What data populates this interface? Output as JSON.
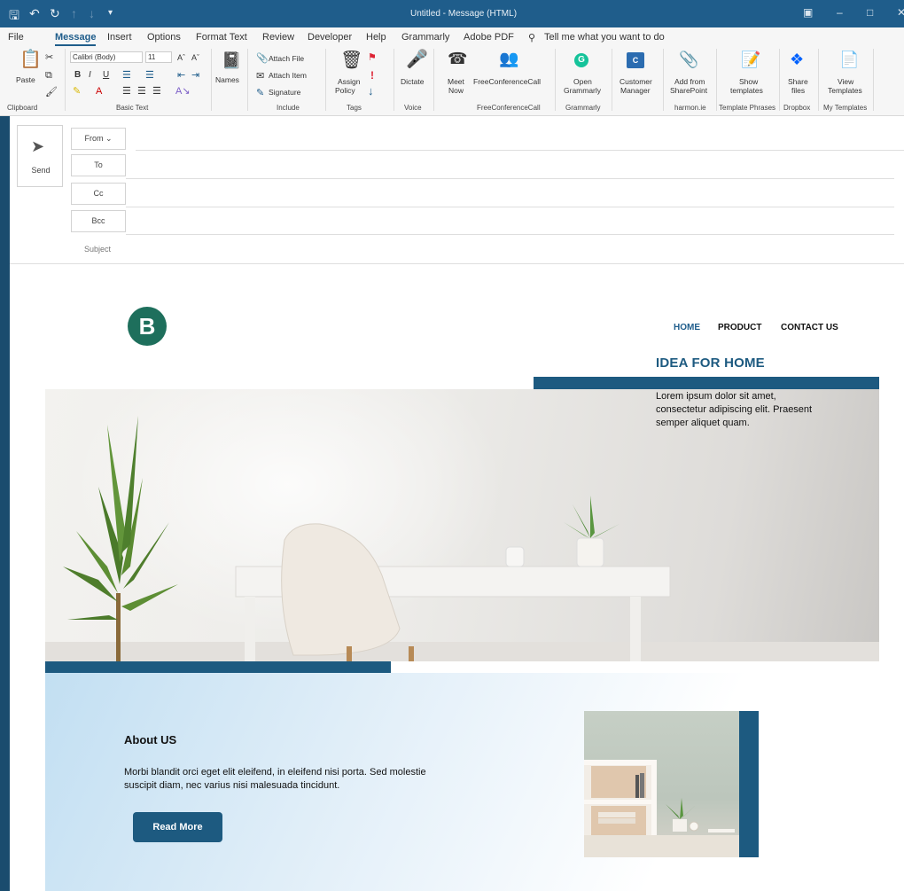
{
  "window": {
    "title": "Untitled  -  Message (HTML)"
  },
  "menu": {
    "items": [
      "File",
      "Message",
      "Insert",
      "Options",
      "Format Text",
      "Review",
      "Developer",
      "Help",
      "Grammarly",
      "Adobe PDF"
    ],
    "tell_me": "Tell me what you want to do"
  },
  "ribbon": {
    "paste": "Paste",
    "font_name": "Calibri (Body)",
    "font_size": "11",
    "names": "Names",
    "attach_file": "Attach File",
    "attach_item": "Attach Item",
    "signature": "Signature",
    "assign_policy_1": "Assign",
    "assign_policy_2": "Policy",
    "dictate": "Dictate",
    "meet_now_1": "Meet",
    "meet_now_2": "Now",
    "freeconference": "FreeConferenceCall",
    "open_grammarly_1": "Open",
    "open_grammarly_2": "Grammarly",
    "customer_manager_1": "Customer",
    "customer_manager_2": "Manager",
    "add_sharepoint_1": "Add from",
    "add_sharepoint_2": "SharePoint",
    "show_templates_1": "Show",
    "show_templates_2": "templates",
    "share_files_1": "Share",
    "share_files_2": "files",
    "view_templates_1": "View",
    "view_templates_2": "Templates",
    "groups": {
      "clipboard": "Clipboard",
      "basic_text": "Basic Text",
      "include": "Include",
      "tags": "Tags",
      "voice": "Voice",
      "freeconferencecall": "FreeConferenceCall",
      "grammarly": "Grammarly",
      "harmonie": "harmon.ie",
      "template_phrases": "Template Phrases",
      "dropbox": "Dropbox",
      "my_templates": "My Templates"
    }
  },
  "compose": {
    "send": "Send",
    "from": "From",
    "to": "To",
    "cc": "Cc",
    "bcc": "Bcc",
    "subject": "Subject"
  },
  "email": {
    "logo": "B",
    "nav": {
      "home": "HOME",
      "product": "PRODUCT",
      "contact": "CONTACT US"
    },
    "hero": {
      "title": "IDEA FOR HOME",
      "text": "Lorem ipsum dolor sit amet, consectetur adipiscing elit. Praesent semper aliquet quam."
    },
    "about": {
      "title": "About US",
      "text": "Morbi blandit orci eget elit eleifend, in eleifend nisi porta. Sed molestie suscipit diam, nec varius nisi malesuada tincidunt.",
      "button": "Read More"
    },
    "colors": {
      "accent": "#1d5a80",
      "logo": "#1e6f5c"
    }
  }
}
